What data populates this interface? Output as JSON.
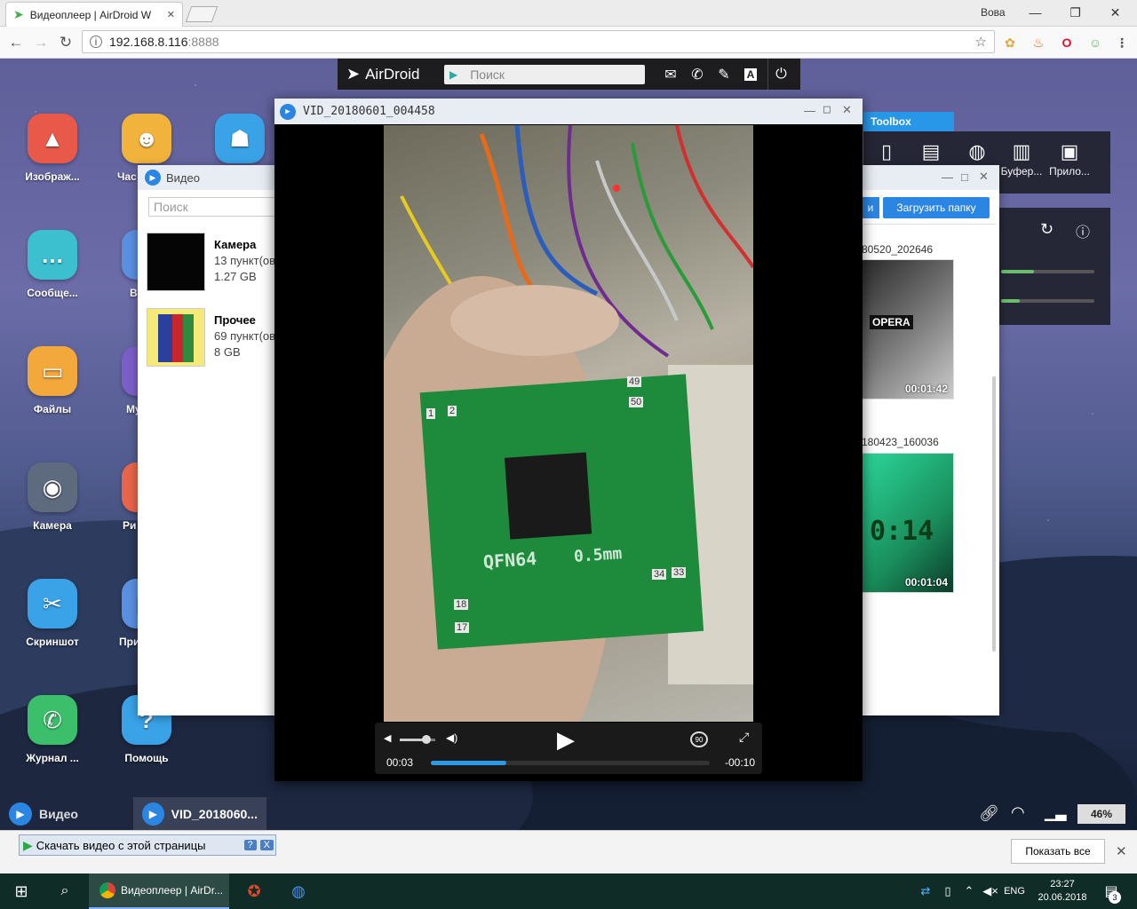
{
  "browser": {
    "tab_title": "Видеоплеер | AirDroid W",
    "user": "Вова",
    "url_host": "192.168.8.116",
    "url_port": ":8888",
    "new_tab": "",
    "btn_min": "—",
    "btn_max": "❐",
    "btn_close": "✕"
  },
  "airdroid_bar": {
    "logo": "AirDroid",
    "search_placeholder": "Поиск"
  },
  "desktop_icons": [
    {
      "label": "Изображ...",
      "color": "#e8594a"
    },
    {
      "label": "Час",
      "color": "#f2b33c"
    },
    {
      "label": "",
      "color": "#3aa3e8"
    },
    {
      "label": "Сообще...",
      "color": "#3cbfcf"
    },
    {
      "label": "В",
      "color": "#5b8fe0"
    },
    {
      "label": "Файлы",
      "color": "#f3a83b"
    },
    {
      "label": "Му",
      "color": "#7b5fc8"
    },
    {
      "label": "Камера",
      "color": "#5e6a7e"
    },
    {
      "label": "Ри",
      "color": "#e8654a"
    },
    {
      "label": "Скриншот",
      "color": "#3aa3e8"
    },
    {
      "label": "При",
      "color": "#5b8fe0"
    },
    {
      "label": "Журнал ...",
      "color": "#3cbf6b"
    },
    {
      "label": "Помощь",
      "color": "#3aa3e8"
    }
  ],
  "toolbox": {
    "tab": "Toolbox",
    "items": [
      {
        "label": ""
      },
      {
        "label": ""
      },
      {
        "label": ""
      },
      {
        "label": "Буфер..."
      },
      {
        "label": "Прило..."
      }
    ],
    "bars": [
      0.35,
      0.2
    ]
  },
  "video_window": {
    "title": "Видео",
    "search_placeholder": "Поиск",
    "upload_folder": "Загрузить папку",
    "upload_other": "и",
    "albums": [
      {
        "name": "Камера",
        "count": "13 пункт(ов",
        "size": "1.27 GB"
      },
      {
        "name": "Прочее",
        "count": "69 пункт(ов",
        "size": "8 GB"
      }
    ],
    "videos": [
      {
        "name": "80520_202646",
        "duration": "00:01:42"
      },
      {
        "name": "180423_160036",
        "duration": "00:01:04"
      }
    ]
  },
  "player": {
    "title": "VID_20180601_004458",
    "time_current": "00:03",
    "time_remaining": "-00:10",
    "progress": 0.27,
    "volume": 0.75,
    "board_text": "QFN64",
    "board_text2": "0.5mm",
    "pins": [
      "49",
      "50",
      "1",
      "2",
      "34",
      "33",
      "18",
      "17"
    ]
  },
  "airdroid_taskbar": {
    "items": [
      {
        "label": "Видео"
      },
      {
        "label": "VID_2018060..."
      }
    ],
    "battery": "46%"
  },
  "downloads": {
    "helper_text": "Скачать видео с этой страницы",
    "helper_help": "?",
    "helper_close": "X",
    "show_all": "Показать все",
    "close": "✕"
  },
  "taskbar": {
    "active_app": "Видеоплеер | AirDr...",
    "lang": "ENG",
    "time": "23:27",
    "date": "20.06.2018",
    "notif_count": "3"
  }
}
